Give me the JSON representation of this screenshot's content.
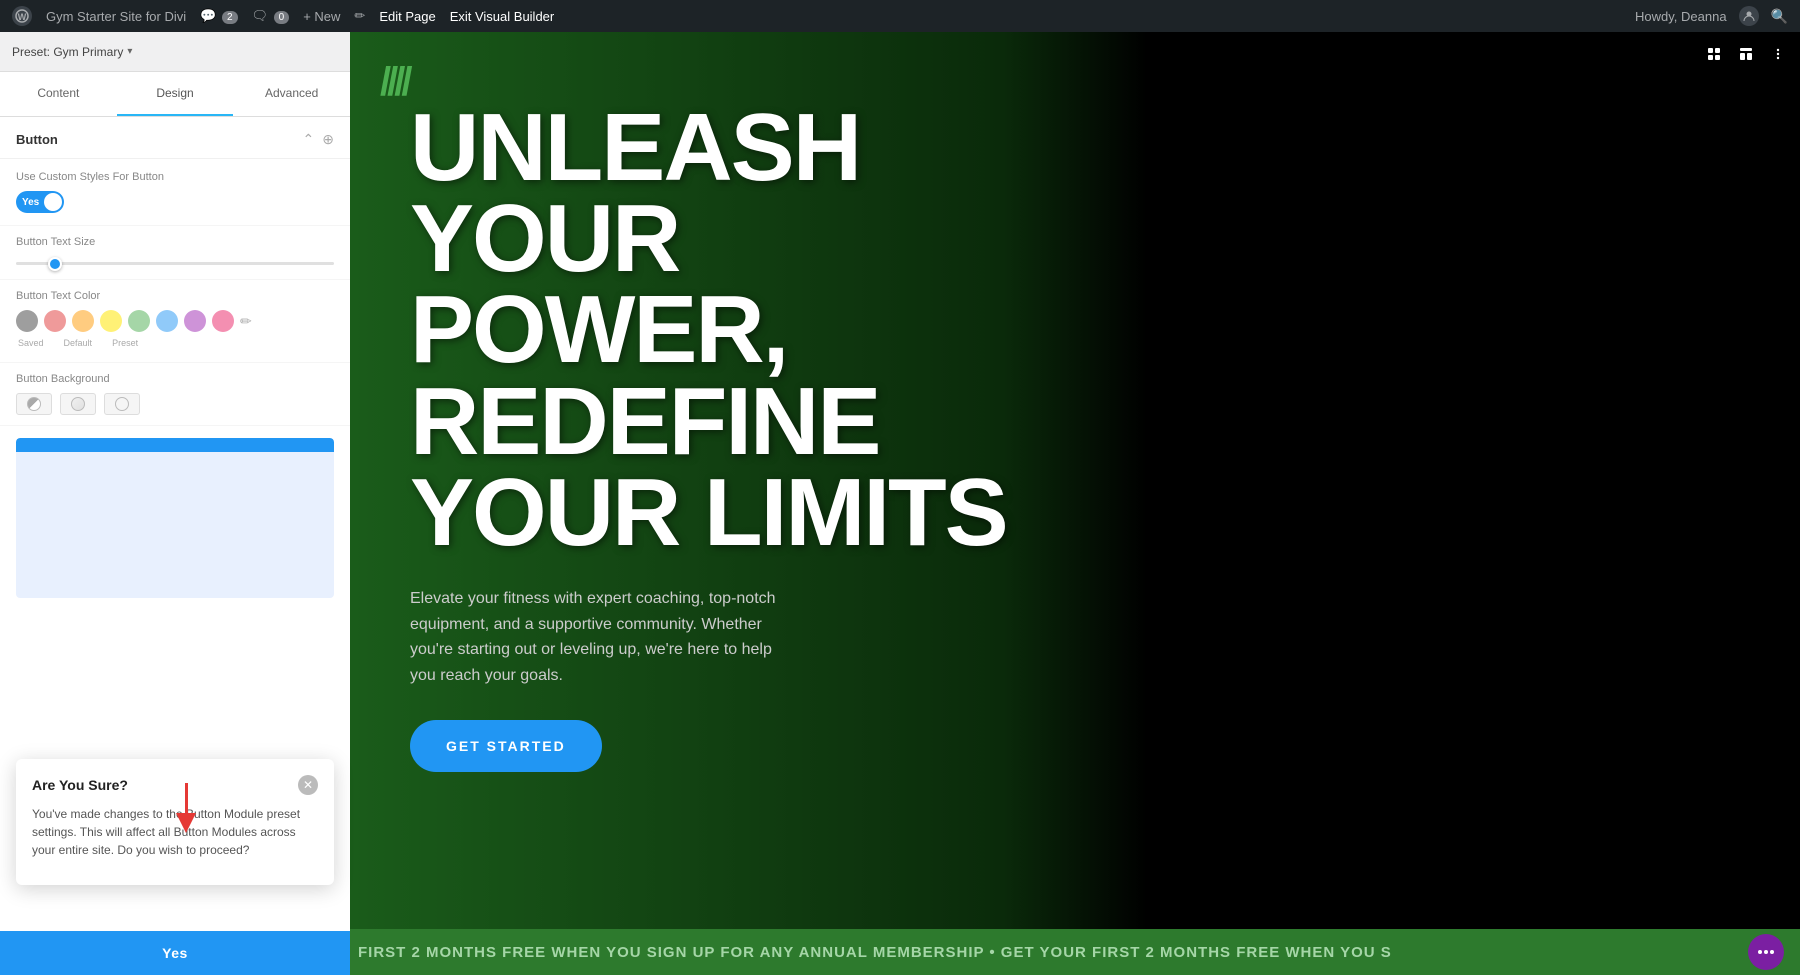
{
  "adminBar": {
    "wp_logo": "W",
    "site_name": "Gym Starter Site for Divi",
    "comments_count": "2",
    "bubbles_count": "0",
    "new_label": "+ New",
    "edit_page_label": "Edit Page",
    "exit_vb_label": "Exit Visual Builder",
    "howdy_label": "Howdy, Deanna"
  },
  "leftPanel": {
    "preset_label": "Preset: Gym Primary",
    "tab_content": "Content",
    "tab_design": "Design",
    "tab_advanced": "Advanced",
    "section_button_title": "Button",
    "custom_styles_label": "Use Custom Styles For Button",
    "toggle_yes": "Yes",
    "button_text_size_label": "Button Text Size",
    "button_text_color_label": "Button Text Color",
    "button_background_label": "Button Background",
    "swatch_saved": "Saved",
    "swatch_default": "Default",
    "swatch_preset": "Preset",
    "swatch_edit": "✏"
  },
  "dialog": {
    "title": "Are You Sure?",
    "body": "You've made changes to the Button Module preset settings. This will affect all Button Modules across your entire site. Do you wish to proceed?",
    "yes_label": "Yes"
  },
  "hero": {
    "slash_marks": "////",
    "title_line1": "UNLEASH YOUR",
    "title_line2": "POWER, REDEFINE",
    "title_line3": "YOUR LIMITS",
    "subtitle": "Elevate your fitness with expert coaching, top-notch equipment, and a supportive community. Whether you're starting out or leveling up, we're here to help you reach your goals.",
    "cta_label": "GET STARTED",
    "ticker_text": "FIRST 2 MONTHS FREE WHEN YOU SIGN UP FOR ANY ANNUAL MEMBERSHIP • GET YOUR FIRST 2 MONTHS FREE WHEN YOU S"
  },
  "vbToolbar": {
    "icon1": "⊞",
    "icon2": "☰",
    "icon3": "⋮"
  }
}
